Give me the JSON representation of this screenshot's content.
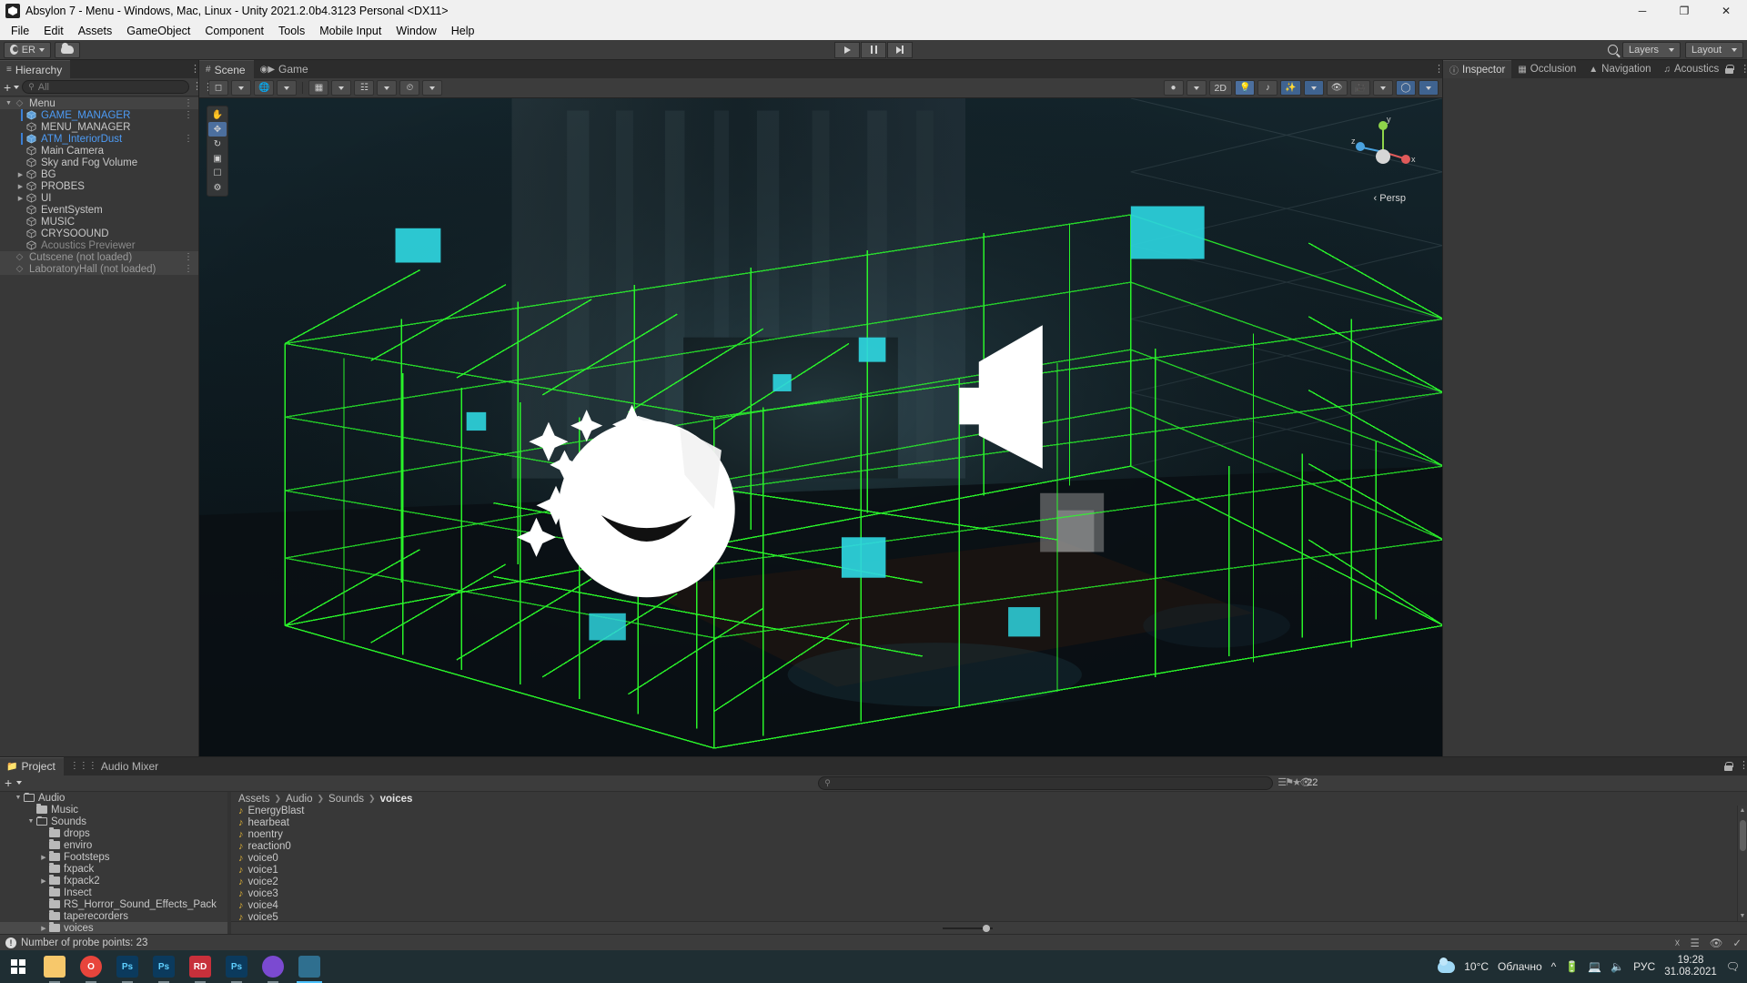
{
  "window": {
    "title": "Absylon 7 - Menu - Windows, Mac, Linux - Unity 2021.2.0b4.3123 Personal <DX11>",
    "minimize": "─",
    "maximize": "❐",
    "close": "✕"
  },
  "menubar": {
    "items": [
      "File",
      "Edit",
      "Assets",
      "GameObject",
      "Component",
      "Tools",
      "Mobile Input",
      "Window",
      "Help"
    ]
  },
  "toolbar": {
    "account_label": "ER",
    "cloud_name": "cloud-icon",
    "play_name": "play-button",
    "pause_name": "pause-button",
    "step_name": "step-button",
    "layers_label": "Layers",
    "layout_label": "Layout",
    "search_name": "search-icon"
  },
  "hierarchy": {
    "tab_label": "Hierarchy",
    "search_placeholder": "All",
    "add_label": "+",
    "items": [
      {
        "label": "Menu",
        "indent": 0,
        "type": "scene-root",
        "arrow": "open",
        "selected": false,
        "dim": false,
        "kebab": true
      },
      {
        "label": "GAME_MANAGER",
        "indent": 1,
        "type": "prefab",
        "arrow": "none",
        "selected": true,
        "dim": false,
        "kebab": true
      },
      {
        "label": "MENU_MANAGER",
        "indent": 1,
        "type": "gameobject",
        "arrow": "none",
        "selected": false,
        "dim": false,
        "kebab": false
      },
      {
        "label": "ATM_InteriorDust",
        "indent": 1,
        "type": "prefab",
        "arrow": "none",
        "selected": true,
        "dim": false,
        "kebab": true
      },
      {
        "label": "Main Camera",
        "indent": 1,
        "type": "gameobject",
        "arrow": "none",
        "selected": false,
        "dim": false,
        "kebab": false
      },
      {
        "label": "Sky and Fog Volume",
        "indent": 1,
        "type": "gameobject",
        "arrow": "none",
        "selected": false,
        "dim": false,
        "kebab": false
      },
      {
        "label": "BG",
        "indent": 1,
        "type": "gameobject",
        "arrow": "closed",
        "selected": false,
        "dim": false,
        "kebab": false
      },
      {
        "label": "PROBES",
        "indent": 1,
        "type": "gameobject",
        "arrow": "closed",
        "selected": false,
        "dim": false,
        "kebab": false
      },
      {
        "label": "UI",
        "indent": 1,
        "type": "gameobject",
        "arrow": "closed",
        "selected": false,
        "dim": false,
        "kebab": false
      },
      {
        "label": "EventSystem",
        "indent": 1,
        "type": "gameobject",
        "arrow": "none",
        "selected": false,
        "dim": false,
        "kebab": false
      },
      {
        "label": "MUSIC",
        "indent": 1,
        "type": "gameobject",
        "arrow": "none",
        "selected": false,
        "dim": false,
        "kebab": false
      },
      {
        "label": "CRYSOOUND",
        "indent": 1,
        "type": "gameobject",
        "arrow": "none",
        "selected": false,
        "dim": false,
        "kebab": false
      },
      {
        "label": "Acoustics Previewer",
        "indent": 1,
        "type": "gameobject",
        "arrow": "none",
        "selected": false,
        "dim": true,
        "kebab": false
      },
      {
        "label": "Cutscene (not loaded)",
        "indent": 0,
        "type": "scene-unloaded",
        "arrow": "none",
        "selected": false,
        "dim": true,
        "kebab": true
      },
      {
        "label": "LaboratoryHall (not loaded)",
        "indent": 0,
        "type": "scene-unloaded",
        "arrow": "none",
        "selected": false,
        "dim": true,
        "kebab": true
      }
    ]
  },
  "scene_panel": {
    "tabs": [
      {
        "label": "Scene",
        "icon": "grid-icon",
        "active": true
      },
      {
        "label": "Game",
        "icon": "gamepad-icon",
        "active": false
      }
    ],
    "toolbar": {
      "shading_mode": "shaded-icon",
      "draw_mode": "globe-icon",
      "mode_2d": "2D",
      "lighting": "light-bulb-icon",
      "audio": "audio-icon",
      "fx": "fx-icon",
      "hidden": "visibility-off-icon",
      "camera": "camera-icon",
      "gizmos": "gizmos-icon",
      "right_tools": [
        "scene-visibility-icon",
        "scene-camera-icon",
        "gizmos-dropdown-icon"
      ]
    },
    "tools": [
      "hand-tool",
      "move-tool",
      "rotate-tool",
      "scale-tool",
      "rect-tool",
      "transform-tool"
    ],
    "active_tool": "move-tool",
    "gizmo": {
      "persp_label": "‹ Persp",
      "axis_x": "x",
      "axis_y": "y",
      "axis_z": "z"
    }
  },
  "inspector": {
    "tabs": [
      {
        "label": "Inspector",
        "icon": "info-icon",
        "active": true
      },
      {
        "label": "Occlusion",
        "icon": "occlusion-icon",
        "active": false
      },
      {
        "label": "Navigation",
        "icon": "navigation-icon",
        "active": false
      },
      {
        "label": "Acoustics",
        "icon": "acoustics-icon",
        "active": false
      }
    ],
    "lock_icon": "lock-icon",
    "kebab_icon": "kebab-menu-icon"
  },
  "project": {
    "tabs": [
      {
        "label": "Project",
        "icon": "folder-icon",
        "active": true
      },
      {
        "label": "Audio Mixer",
        "icon": "mixer-icon",
        "active": false
      }
    ],
    "add_label": "+",
    "search_placeholder": "",
    "count_badge": "22",
    "tree": [
      {
        "label": "Audio",
        "indent": 0,
        "arrow": "open",
        "selected": false
      },
      {
        "label": "Music",
        "indent": 1,
        "arrow": "none",
        "selected": false
      },
      {
        "label": "Sounds",
        "indent": 1,
        "arrow": "open",
        "selected": false
      },
      {
        "label": "drops",
        "indent": 2,
        "arrow": "none",
        "selected": false
      },
      {
        "label": "enviro",
        "indent": 2,
        "arrow": "none",
        "selected": false
      },
      {
        "label": "Footsteps",
        "indent": 2,
        "arrow": "closed",
        "selected": false
      },
      {
        "label": "fxpack",
        "indent": 2,
        "arrow": "none",
        "selected": false
      },
      {
        "label": "fxpack2",
        "indent": 2,
        "arrow": "closed",
        "selected": false
      },
      {
        "label": "Insect",
        "indent": 2,
        "arrow": "none",
        "selected": false
      },
      {
        "label": "RS_Horror_Sound_Effects_Pack",
        "indent": 2,
        "arrow": "none",
        "selected": false
      },
      {
        "label": "taperecorders",
        "indent": 2,
        "arrow": "none",
        "selected": false
      },
      {
        "label": "voices",
        "indent": 2,
        "arrow": "closed",
        "selected": true
      }
    ],
    "breadcrumb": [
      "Assets",
      "Audio",
      "Sounds",
      "voices"
    ],
    "files": [
      {
        "label": "EnergyBlast",
        "icon": "audio-clip-icon"
      },
      {
        "label": "hearbeat",
        "icon": "audio-clip-icon"
      },
      {
        "label": "noentry",
        "icon": "audio-clip-icon"
      },
      {
        "label": "reaction0",
        "icon": "audio-clip-icon"
      },
      {
        "label": "voice0",
        "icon": "audio-clip-icon"
      },
      {
        "label": "voice1",
        "icon": "audio-clip-icon"
      },
      {
        "label": "voice2",
        "icon": "audio-clip-icon"
      },
      {
        "label": "voice3",
        "icon": "audio-clip-icon"
      },
      {
        "label": "voice4",
        "icon": "audio-clip-icon"
      },
      {
        "label": "voice5",
        "icon": "audio-clip-icon"
      }
    ]
  },
  "statusbar": {
    "message": "Number of probe points: 23",
    "icons": [
      "api-update-icon",
      "collab-icon",
      "visibility-icon",
      "check-icon"
    ]
  },
  "taskbar": {
    "start_label": "start-button",
    "apps": [
      {
        "name": "file-explorer",
        "label": "",
        "color": "#f7c86b"
      },
      {
        "name": "opera-browser",
        "label": "O",
        "color": "#e8453c"
      },
      {
        "name": "photoshop-1",
        "label": "Ps",
        "color": "#0b3a5d"
      },
      {
        "name": "photoshop-2",
        "label": "Ps",
        "color": "#0b3a5d"
      },
      {
        "name": "rider-ide",
        "label": "RD",
        "color": "#c7303b"
      },
      {
        "name": "photoshop-3",
        "label": "Ps",
        "color": "#0b3a5d"
      },
      {
        "name": "chat-app",
        "label": "",
        "color": "#7b4ad1"
      },
      {
        "name": "unity-editor",
        "label": "",
        "color": "#2f6f8f"
      }
    ],
    "weather_temp": "10°C",
    "weather_text": "Облачно",
    "language": "РУС",
    "time": "19:28",
    "date": "31.08.2021"
  },
  "colors": {
    "accent_blue": "#4d9bf5",
    "selection_bar": "#3b7fd4",
    "wireframe_green": "#2bff2b",
    "probe_cyan": "#38d8d8",
    "panel_bg": "#383838",
    "tab_bg": "#2c2c2c",
    "toolbar_bg": "#3c3c3c",
    "taskbar_bg": "#1f2e33",
    "audio_yellow": "#e0b235"
  }
}
